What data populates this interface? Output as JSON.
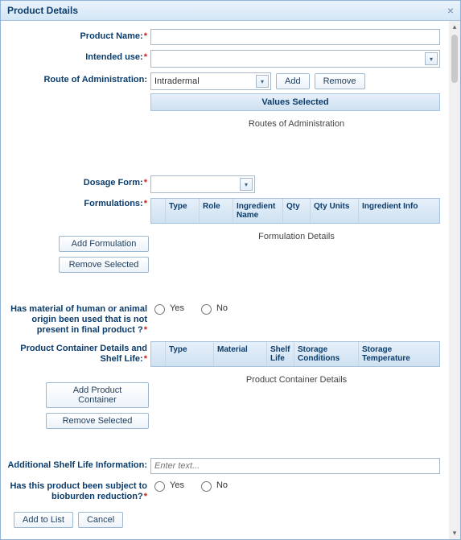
{
  "dialog": {
    "title": "Product Details"
  },
  "product": {
    "name_label": "Product Name:",
    "name_value": "",
    "intended_use_label": "Intended use:",
    "intended_use_value": "",
    "route_admin_label": "Route of Administration:",
    "route_admin_value": "Intradermal",
    "route_add": "Add",
    "route_remove": "Remove",
    "values_selected_header": "Values Selected",
    "routes_caption": "Routes of Administration"
  },
  "dosage": {
    "dosage_form_label": "Dosage Form:",
    "dosage_form_value": "",
    "formulations_label": "Formulations:",
    "formulation_headers": [
      "Type",
      "Role",
      "Ingredient Name",
      "Qty",
      "Qty Units",
      "Ingredient Info"
    ],
    "add_formulation": "Add Formulation",
    "remove_selected": "Remove Selected",
    "formulation_caption": "Formulation Details"
  },
  "origin": {
    "question_label": "Has material of human or animal origin been used that is not present in final product ?",
    "yes": "Yes",
    "no": "No"
  },
  "container": {
    "label": "Product Container Details and Shelf Life:",
    "headers": [
      "Type",
      "Material",
      "Shelf Life",
      "Storage Conditions",
      "Storage Temperature"
    ],
    "add_container": "Add Product Container",
    "remove_selected": "Remove Selected",
    "caption": "Product Container Details"
  },
  "shelf": {
    "addl_label": "Additional Shelf Life Information:",
    "addl_placeholder": "Enter text...",
    "addl_value": ""
  },
  "bioburden": {
    "label": "Has this product been subject to bioburden reduction?",
    "yes": "Yes",
    "no": "No"
  },
  "footer": {
    "add_to_list": "Add to List",
    "cancel": "Cancel"
  }
}
